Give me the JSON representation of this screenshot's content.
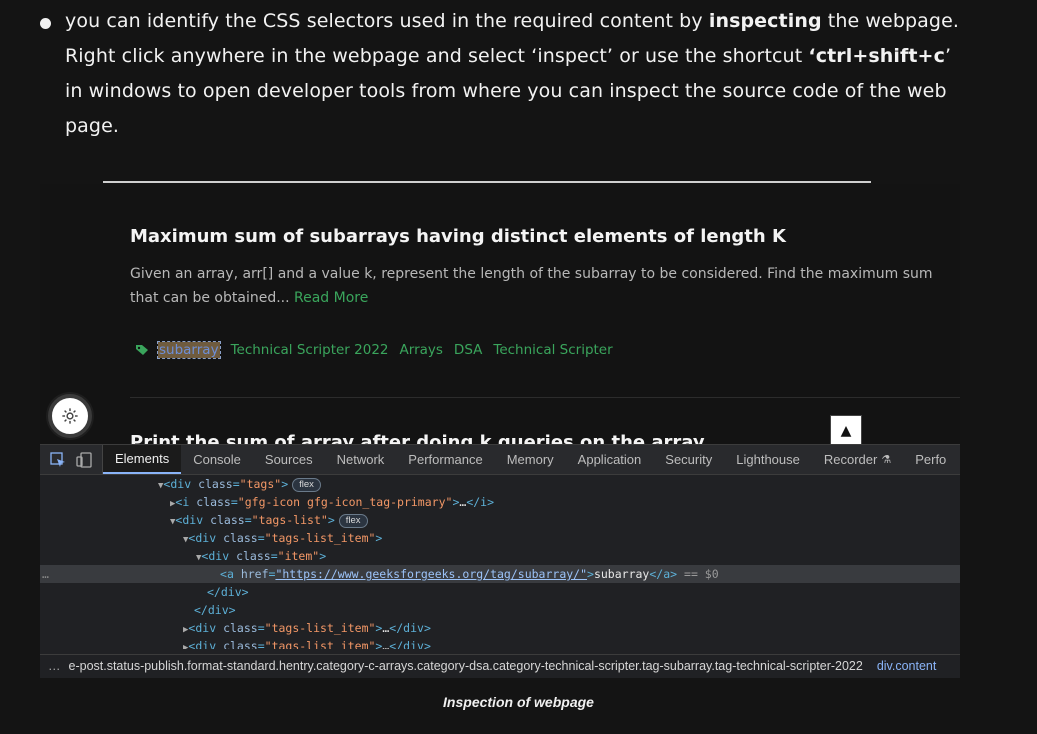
{
  "article": {
    "bullet_part1": "you can identify the CSS selectors used in the required content by ",
    "bullet_bold1": "inspecting",
    "bullet_part2": " the webpage. Right click anywhere in the webpage and select ‘inspect’ or use the shortcut ",
    "bullet_bold2": "‘ctrl+shift+c",
    "bullet_part3": "’ in windows to open developer tools from where you can inspect the source code of the web page."
  },
  "card": {
    "title": "Maximum sum of subarrays having distinct elements of length K",
    "description": "Given an array, arr[] and a value k, represent the length of the subarray to be considered. Find the maximum sum that can be obtained... ",
    "read_more": "Read More",
    "tags": [
      "subarray",
      "Technical Scripter 2022",
      "Arrays",
      "DSA",
      "Technical Scripter"
    ],
    "next_title": "Print the sum of array after doing k queries on the array"
  },
  "devtools": {
    "tabs": [
      "Elements",
      "Console",
      "Sources",
      "Network",
      "Performance",
      "Memory",
      "Application",
      "Security",
      "Lighthouse",
      "Recorder",
      "Perfo"
    ],
    "active_tab": "Elements",
    "dom": {
      "l1_tag": "div",
      "l1_attr": "class",
      "l1_val": "\"tags\"",
      "l1_pill": "flex",
      "l2_tag": "i",
      "l2_attr": "class",
      "l2_val": "\"gfg-icon gfg-icon_tag-primary\"",
      "l2_ell": "…",
      "l3_tag": "div",
      "l3_attr": "class",
      "l3_val": "\"tags-list\"",
      "l3_pill": "flex",
      "l4_tag": "div",
      "l4_attr": "class",
      "l4_val": "\"tags-list_item\"",
      "l5_tag": "div",
      "l5_attr": "class",
      "l5_val": "\"item\"",
      "l6_tag": "a",
      "l6_attr": "href",
      "l6_val": "\"https://www.geeksforgeeks.org/tag/subarray/\"",
      "l6_text": "subarray",
      "l6_eq": "== $0",
      "l7": "</div>",
      "l8": "</div>",
      "l9_tag": "div",
      "l9_attr": "class",
      "l9_val": "\"tags-list_item\"",
      "l9_ell": "…",
      "l10_tag": "div",
      "l10_attr": "class",
      "l10_val": "\"tags-list_item\"",
      "l10_ell": "…",
      "row_dots": "…"
    },
    "breadcrumb": "e-post.status-publish.format-standard.hentry.category-c-arrays.category-dsa.category-technical-scripter.tag-subarray.tag-technical-scripter-2022",
    "breadcrumb_end": "div.content",
    "breadcrumb_dots": "…"
  },
  "caption": "Inspection of webpage",
  "colors": {
    "accent_green": "#3aa55c",
    "devtools_bg": "#202124",
    "tag_blue": "#5db0d7",
    "attr_orange": "#f29766"
  }
}
